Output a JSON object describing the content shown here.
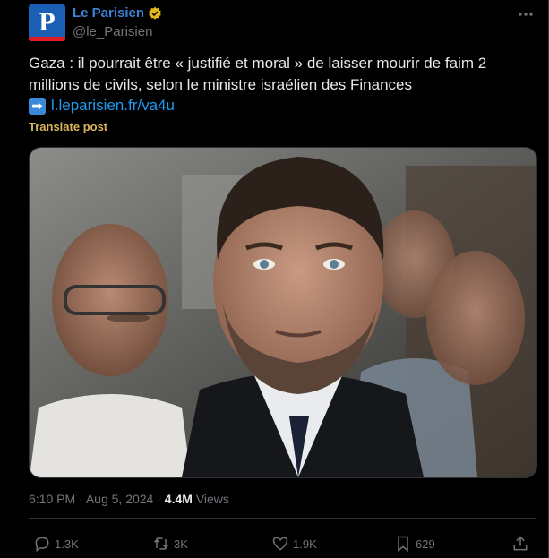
{
  "account": {
    "avatar_letter": "P",
    "display_name": "Le Parisien",
    "handle": "@le_Parisien",
    "verified_color": "#e2b719"
  },
  "tweet": {
    "text": "Gaza : il pourrait être « justifié et moral » de laisser mourir de faim 2 millions de civils, selon le ministre israélien des Finances",
    "link_arrow": "➡",
    "link": "l.leparisien.fr/va4u",
    "translate_label": "Translate post",
    "time": "6:10 PM",
    "date": "Aug 5, 2024",
    "views_count": "4.4M",
    "views_label": "Views",
    "separator": "·"
  },
  "actions": {
    "reply_count": "1.3K",
    "retweet_count": "3K",
    "like_count": "1.9K",
    "bookmark_count": "629"
  },
  "colors": {
    "background": "#000000",
    "text": "#e7e9ea",
    "muted": "#71767b",
    "link": "#1d9bf0",
    "border": "#2f3336"
  }
}
